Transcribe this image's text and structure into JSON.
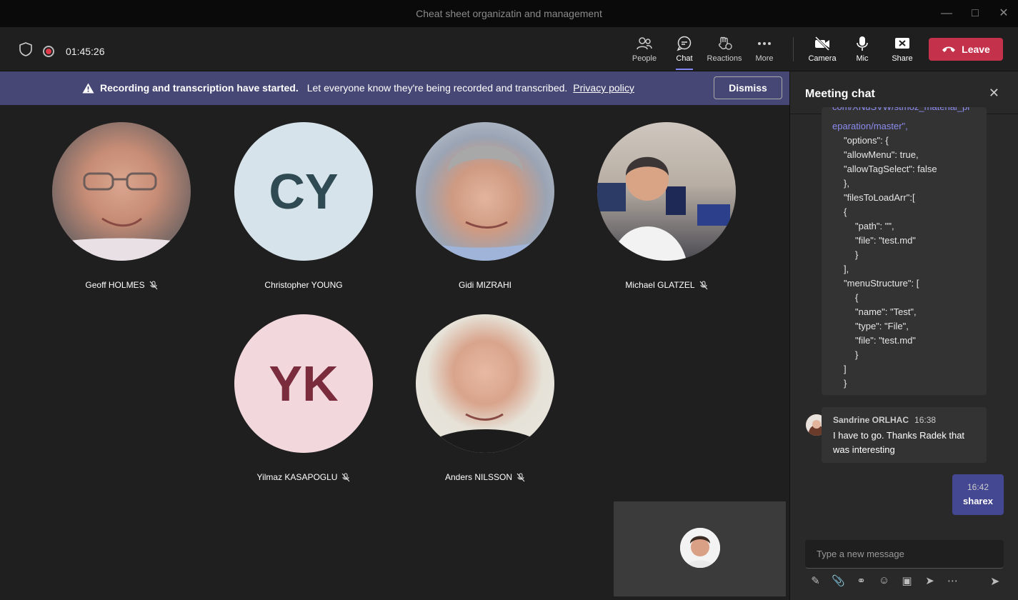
{
  "window": {
    "title": "Cheat sheet organizatin and management"
  },
  "toolbar": {
    "timer": "01:45:26",
    "buttons": [
      {
        "label": "People",
        "icon": "people-icon"
      },
      {
        "label": "Chat",
        "icon": "chat-icon"
      },
      {
        "label": "Reactions",
        "icon": "reactions-icon"
      },
      {
        "label": "More",
        "icon": "more-icon"
      },
      {
        "label": "Camera",
        "icon": "camera-off-icon"
      },
      {
        "label": "Mic",
        "icon": "mic-icon"
      },
      {
        "label": "Share",
        "icon": "share-icon"
      }
    ],
    "leave_label": "Leave"
  },
  "banner": {
    "bold": "Recording and transcription have started.",
    "text": "Let everyone know they're being recorded and transcribed.",
    "link": "Privacy policy",
    "dismiss": "Dismiss"
  },
  "participants": [
    {
      "name": "Geoff HOLMES",
      "muted": true,
      "initials": ""
    },
    {
      "name": "Christopher YOUNG",
      "muted": false,
      "initials": "CY"
    },
    {
      "name": "Gidi MIZRAHI",
      "muted": false,
      "initials": ""
    },
    {
      "name": "Michael GLATZEL",
      "muted": true,
      "initials": ""
    },
    {
      "name": "Yilmaz KASAPOGLU",
      "muted": true,
      "initials": "YK"
    },
    {
      "name": "Anders NILSSON",
      "muted": true,
      "initials": ""
    }
  ],
  "chat": {
    "title": "Meeting chat",
    "code_lines": [
      "com/XNuSVW/stmoz_material_pr",
      "eparation/master\",",
      "\"options\": {",
      "\"allowMenu\": true,",
      "\"allowTagSelect\": false",
      "},",
      "\"filesToLoadArr\":[",
      "{",
      "\"path\": \"\",",
      "\"file\": \"test.md\"",
      "}",
      "],",
      "\"menuStructure\": [",
      "{",
      "\"name\": \"Test\",",
      "\"type\": \"File\",",
      "\"file\": \"test.md\"",
      "}",
      "]",
      "}"
    ],
    "message": {
      "author": "Sandrine ORLHAC",
      "time": "16:38",
      "text": "I have to go. Thanks Radek that was interesting"
    },
    "my_message": {
      "time": "16:42",
      "text": "sharex"
    },
    "compose_placeholder": "Type a new message"
  }
}
